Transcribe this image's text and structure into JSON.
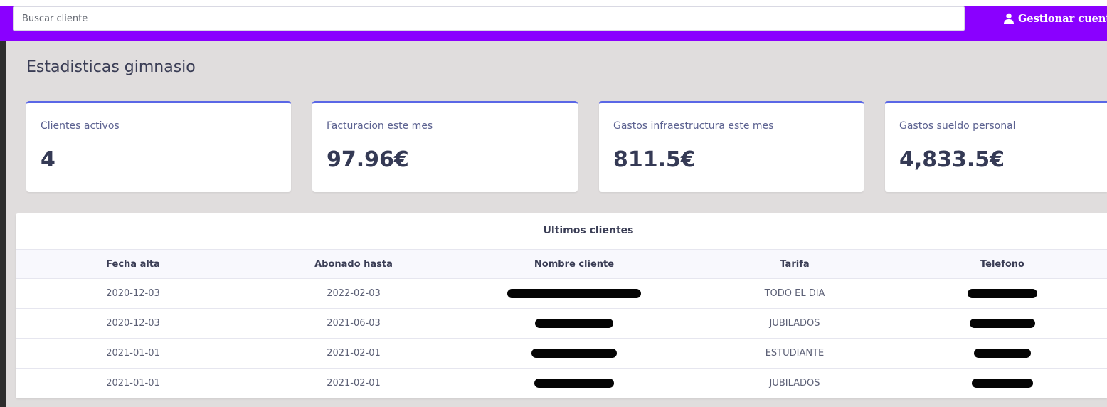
{
  "header": {
    "search_placeholder": "Buscar cliente",
    "account_label": "Gestionar cuenta",
    "account_icon": "user-icon"
  },
  "page": {
    "title": "Estadisticas gimnasio"
  },
  "stats": [
    {
      "label": "Clientes activos",
      "value": "4"
    },
    {
      "label": "Facturacion este mes",
      "value": "97.96€"
    },
    {
      "label": "Gastos infraestructura este mes",
      "value": "811.5€"
    },
    {
      "label": "Gastos sueldo personal",
      "value": "4,833.5€"
    }
  ],
  "clients_table": {
    "title": "Ultimos clientes",
    "columns": [
      "Fecha alta",
      "Abonado hasta",
      "Nombre cliente",
      "Tarifa",
      "Telefono"
    ],
    "rows": [
      {
        "fecha_alta": "2020-12-03",
        "abonado_hasta": "2022-02-03",
        "nombre": "",
        "tarifa": "TODO EL DIA",
        "telefono": ""
      },
      {
        "fecha_alta": "2020-12-03",
        "abonado_hasta": "2021-06-03",
        "nombre": "",
        "tarifa": "JUBILADOS",
        "telefono": ""
      },
      {
        "fecha_alta": "2021-01-01",
        "abonado_hasta": "2021-02-01",
        "nombre": "",
        "tarifa": "ESTUDIANTE",
        "telefono": ""
      },
      {
        "fecha_alta": "2021-01-01",
        "abonado_hasta": "2021-02-01",
        "nombre": "",
        "tarifa": "JUBILADOS",
        "telefono": ""
      }
    ]
  },
  "colors": {
    "header_bg": "#8a00ff",
    "card_accent": "#5a67e6",
    "page_bg": "#e0dddd"
  }
}
